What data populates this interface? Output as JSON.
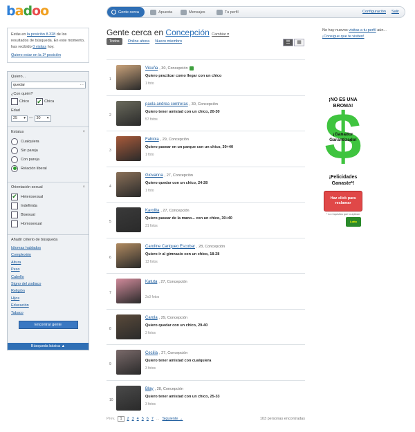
{
  "logo": [
    "b",
    "a",
    "d",
    "o",
    "o"
  ],
  "nav": {
    "tabs": [
      "Gente cerca",
      "Apuesta",
      "Mensajes",
      "Tu perfil"
    ],
    "config": "Configuración",
    "exit": "Salir"
  },
  "info": {
    "pre": "Estás en",
    "position": "la posición 8.328",
    "mid": "de los resultados de búsqueda. En este momento, has recibido",
    "visits": "0 visitas",
    "post": "hoy.",
    "promo": "Quiero estar en la 1ª posición"
  },
  "filter": {
    "want_label": "Quiero...",
    "want_value": "quedar",
    "who_label": "¿Con quién?",
    "chico": "Chico",
    "chica": "Chica",
    "age_label": "Edad",
    "age_from": "25",
    "age_to": "30",
    "status_title": "Estatus",
    "status_options": [
      "Cualquiera",
      "Sin pareja",
      "Con pareja",
      "Relación liberal"
    ],
    "orient_title": "Orientación sexual",
    "orient_options": [
      "Heterosexual",
      "Indefinida",
      "Bisexual",
      "Homosexual"
    ],
    "criteria_title": "Añadir criterio de búsqueda",
    "criteria": [
      "Idiomas hablados",
      "Complexión",
      "Altura",
      "Peso",
      "Cabello",
      "Signo del zodiaco",
      "Religión",
      "Hijos",
      "Educación",
      "Tabaco"
    ],
    "find_button": "Encontrar gente",
    "advanced": "Búsqueda básica ▲"
  },
  "main": {
    "title_prefix": "Gente cerca en",
    "city": "Concepción",
    "change": "Cambiar ▾",
    "filter_all": "Todos",
    "filter_online": "Online ahora",
    "filter_new": "Nuevo miembro"
  },
  "people": [
    {
      "num": "1",
      "name": "Vicuña",
      "meta": ", 30, Concepción",
      "online": true,
      "want": "Quiero practicar como llegar con un chico",
      "photos": "1 foto"
    },
    {
      "num": "2",
      "name": "paola andrea contreras",
      "meta": ", 30, Concepción",
      "online": false,
      "want": "Quiero tener amistad con un chico, 20-30",
      "photos": "57 fotos"
    },
    {
      "num": "3",
      "name": "Fabiola",
      "meta": ", 29, Concepción",
      "online": false,
      "want": "Quiero pasear en un parque con un chico, 30+40",
      "photos": "1 foto"
    },
    {
      "num": "4",
      "name": "Giovanna",
      "meta": ", 27, Concepción",
      "online": false,
      "want": "Quiero quedar con un chico, 24-28",
      "photos": "1 foto"
    },
    {
      "num": "5",
      "name": "Karolita",
      "meta": ", 27, Concepción",
      "online": false,
      "want": "Quiero pasear de la mano... con un chico, 30+40",
      "photos": "31 fotos"
    },
    {
      "num": "6",
      "name": "Caroline Cariqueo Escobar",
      "meta": ", 28, Concepción",
      "online": false,
      "want": "Quiero ir al gimnasio con un chico, 18-28",
      "photos": "13 fotos"
    },
    {
      "num": "7",
      "name": "Katuta",
      "meta": ", 27, Concepción",
      "online": false,
      "want": "",
      "photos": "2x3 fotos"
    },
    {
      "num": "8",
      "name": "Carola",
      "meta": ", 29, Concepción",
      "online": false,
      "want": "Quiero quedar con un chico, 29-40",
      "photos": "3 fotos"
    },
    {
      "num": "9",
      "name": "Cecilia",
      "meta": ", 27, Concepción",
      "online": false,
      "want": "Quiero tener amistad con cualquiera",
      "photos": "3 fotos"
    },
    {
      "num": "10",
      "name": "Blay",
      "meta": ", 28, Concepción",
      "online": false,
      "want": "Quiero tener amistad con un chico, 25-33",
      "photos": "3 fotos"
    }
  ],
  "pager": {
    "prev": "Prev.",
    "pages": [
      "1",
      "2",
      "3",
      "4",
      "5",
      "6",
      "7"
    ],
    "ellipsis": "...",
    "next": "Siguiente →",
    "count": "103 personas encontradas"
  },
  "right": {
    "text": "No hay nuevos",
    "link1": "visitas a tu perfil",
    "text2": "aún...",
    "link2": "¡Consigue que te visiten!"
  },
  "ad": {
    "h1": "¡NO ES UNA BROMA!",
    "symbol": "$",
    "ganador": "¡Ganador Garantizado!",
    "h2": "¡Felicidades Ganaste*!",
    "btn": "Haz click para reclamar",
    "fine": "* Lo requisitos que lo aplican",
    "logo": "Lotto"
  },
  "colors": {
    "logo": [
      "#2d7fd8",
      "#f0a020",
      "#3da03d",
      "#e84a4a",
      "#f0a020"
    ],
    "photos": [
      "#c9a27a",
      "#6a6a5c",
      "#a85a3a",
      "#8a7058",
      "#3a3a3a",
      "#b08a60",
      "#d08a9a",
      "#5a4a3a",
      "#7a6a6a",
      "#4a4a4a"
    ]
  }
}
